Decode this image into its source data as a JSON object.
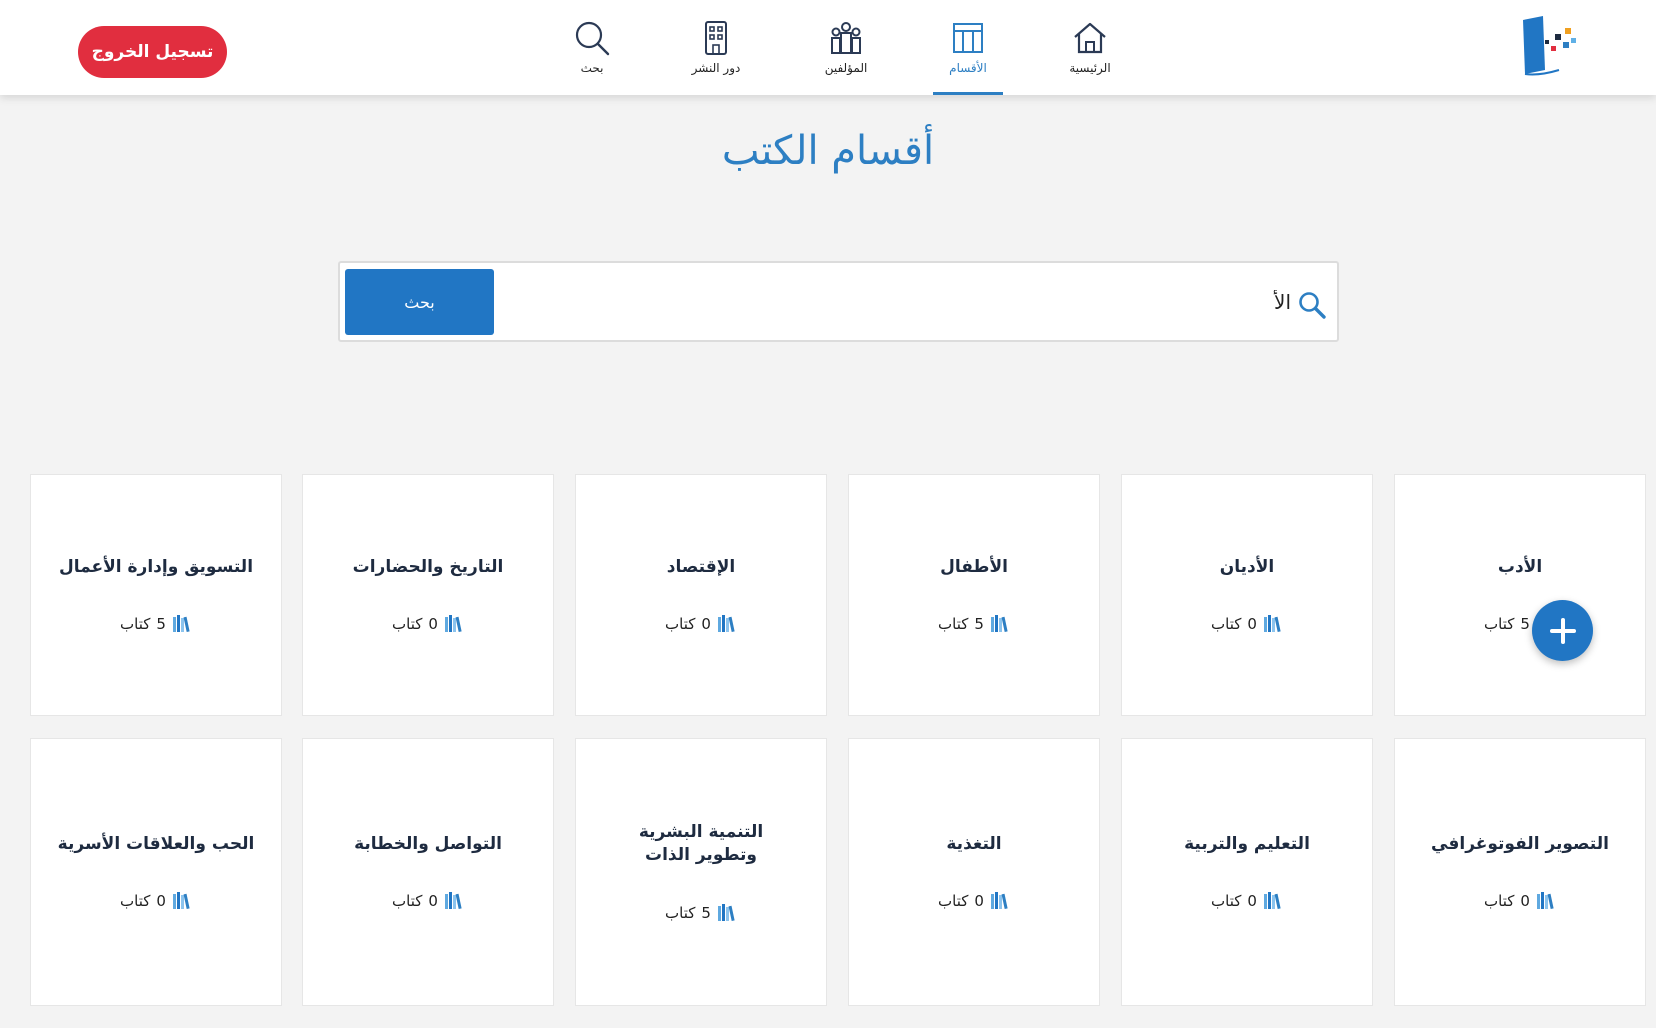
{
  "nav": {
    "items": [
      {
        "label": "الرئيسية",
        "icon": "home-icon"
      },
      {
        "label": "الأقسام",
        "icon": "sections-icon",
        "active": true
      },
      {
        "label": "المؤلفين",
        "icon": "authors-icon"
      },
      {
        "label": "دور النشر",
        "icon": "building-icon"
      },
      {
        "label": "بحث",
        "icon": "search-icon"
      }
    ],
    "logout_label": "تسجيل الخروج"
  },
  "page": {
    "title": "أقسام الكتب"
  },
  "search": {
    "value": "الأ",
    "button_label": "بحث"
  },
  "categories": [
    {
      "title": "الأدب",
      "count": "5",
      "unit": "كتاب"
    },
    {
      "title": "الأديان",
      "count": "0",
      "unit": "كتاب"
    },
    {
      "title": "الأطفال",
      "count": "5",
      "unit": "كتاب"
    },
    {
      "title": "الإقتصاد",
      "count": "0",
      "unit": "كتاب"
    },
    {
      "title": "التاريخ والحضارات",
      "count": "0",
      "unit": "كتاب"
    },
    {
      "title": "التسويق وإدارة الأعمال",
      "count": "5",
      "unit": "كتاب"
    },
    {
      "title": "التصوير الفوتوغرافي",
      "count": "0",
      "unit": "كتاب"
    },
    {
      "title": "التعليم والتربية",
      "count": "0",
      "unit": "كتاب"
    },
    {
      "title": "التغذية",
      "count": "0",
      "unit": "كتاب"
    },
    {
      "title": "التنمية البشرية وتطوير الذات",
      "count": "5",
      "unit": "كتاب"
    },
    {
      "title": "التواصل والخطابة",
      "count": "0",
      "unit": "كتاب"
    },
    {
      "title": "الحب والعلاقات الأسرية",
      "count": "0",
      "unit": "كتاب"
    }
  ],
  "colors": {
    "accent": "#2176c4",
    "title": "#2d7fc3",
    "logout": "#e12e3f",
    "background": "#f3f3f3"
  }
}
